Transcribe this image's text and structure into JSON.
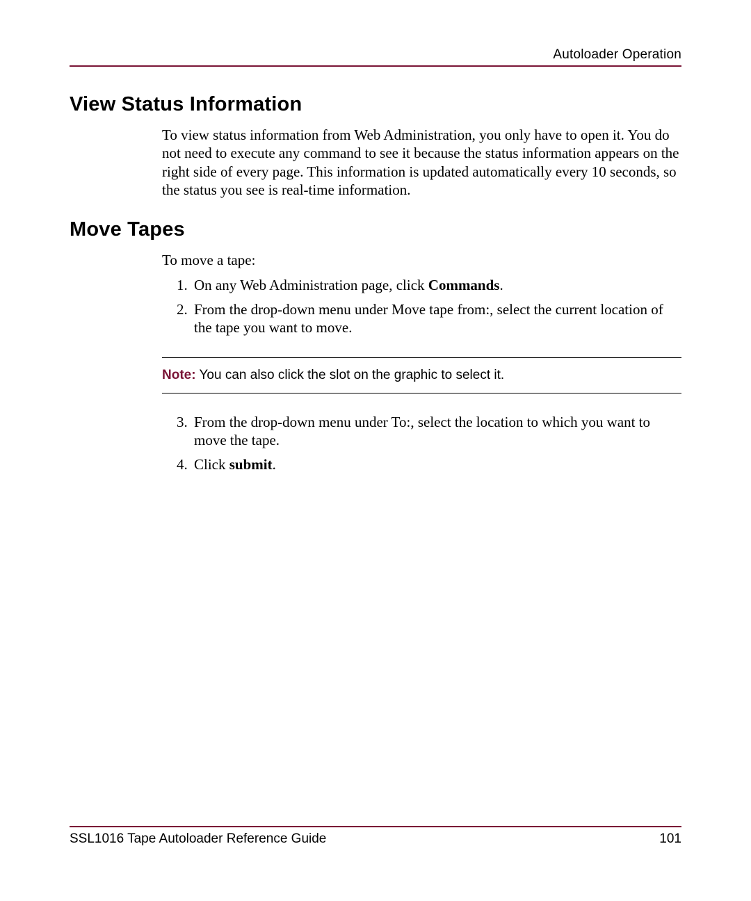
{
  "header": {
    "chapter": "Autoloader Operation"
  },
  "sections": {
    "view_status": {
      "heading": "View Status Information",
      "paragraph": "To view status information from Web Administration, you only have to open it. You do not need to execute any command to see it because the status information appears on the right side of every page. This information is updated automatically every 10 seconds, so the status you see is real-time information."
    },
    "move_tapes": {
      "heading": "Move Tapes",
      "intro": "To move a tape:",
      "step1_pre": "On any Web Administration page, click ",
      "step1_bold": "Commands",
      "step1_post": ".",
      "step2": "From the drop-down menu under Move tape from:, select the current location of the tape you want to move.",
      "note_label": "Note:",
      "note_text": "  You can also click the slot on the graphic to select it.",
      "step3": "From the drop-down menu under To:, select the location to which you want to move the tape.",
      "step4_pre": "Click ",
      "step4_bold": "submit",
      "step4_post": "."
    }
  },
  "footer": {
    "guide": "SSL1016 Tape Autoloader Reference Guide",
    "page": "101"
  }
}
